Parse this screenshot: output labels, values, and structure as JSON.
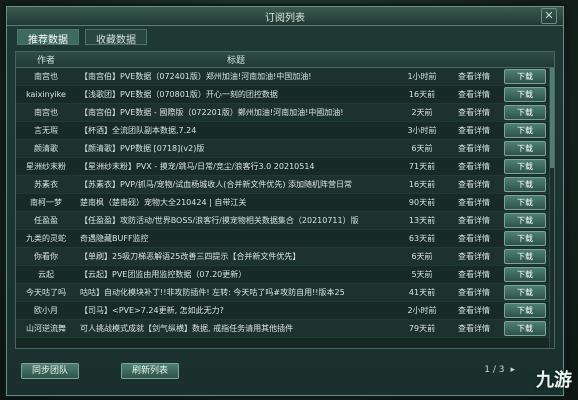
{
  "window": {
    "title": "订阅列表"
  },
  "tabs": [
    {
      "label": "推荐数据",
      "active": true
    },
    {
      "label": "收藏数据",
      "active": false
    }
  ],
  "table": {
    "headers": [
      "作者",
      "标题",
      "",
      "",
      ""
    ],
    "rows": [
      {
        "author": "南宫也",
        "title": "【南宫伯】PVE数据（072401版）郑州加油!河南加油!中国加油!",
        "time": "1小时前",
        "detail": "查看详情",
        "download": "下载"
      },
      {
        "author": "kaixinyike",
        "title": "【浅歌团】PVE数据（070801版）开心一刻的团控数据",
        "time": "16天前",
        "detail": "查看详情",
        "download": "下载"
      },
      {
        "author": "南宫也",
        "title": "【南宫伯】PVE数据 - 國際版（072201版）鄭州加油!河南加油!中國加油!",
        "time": "2天前",
        "detail": "查看详情",
        "download": "下载"
      },
      {
        "author": "言无瑕",
        "title": "【杯酒】全流团队副本数据,7.24",
        "time": "3小时前",
        "detail": "查看详情",
        "download": "下载"
      },
      {
        "author": "颜清歌",
        "title": "【颜清歌】PVP数据 [0718](v2)版",
        "time": "6天前",
        "detail": "查看详情",
        "download": "下载"
      },
      {
        "author": "星洲纱末粉",
        "title": "【星洲纱末粉】PVX - 摸宠/跳马/日常/竞尘/浪客行3.0 20210514",
        "time": "71天前",
        "detail": "查看详情",
        "download": "下载"
      },
      {
        "author": "苏素衣",
        "title": "【苏素衣】PVP/抓马/宠物/试血杨城收人(合并新文件优先) 添加随机阵营日常",
        "time": "16天前",
        "detail": "查看详情",
        "download": "下载"
      },
      {
        "author": "南柯一梦",
        "title": "楚南枫（楚南砚）宠物大全210424 | 自带江关",
        "time": "90天前",
        "detail": "查看详情",
        "download": "下载"
      },
      {
        "author": "任盈盈",
        "title": "【任盈盈】攻防活动/世界BOSS/浪客行/摸宠物相关数据集合（20210711）版",
        "time": "13天前",
        "detail": "查看详情",
        "download": "下载"
      },
      {
        "author": "九类的灵蛇",
        "title": "奇遇隐藏BUFF监控",
        "time": "63天前",
        "detail": "查看详情",
        "download": "下载"
      },
      {
        "author": "你看你",
        "title": "【单刷】25吸刀梯恶解语25改善三四提示【合并新文件优先】",
        "time": "6天前",
        "detail": "查看详情",
        "download": "下载"
      },
      {
        "author": "云起",
        "title": "【云起】PVE团监由用监控数据（07.20更新）",
        "time": "5天前",
        "detail": "查看详情",
        "download": "下载"
      },
      {
        "author": "今天咕了吗",
        "title": "咕咕】自动化模块补丁!!非攻防插件! 左转: 今天咕了吗#攻防自用!!版本25",
        "time": "41天前",
        "detail": "查看详情",
        "download": "下载"
      },
      {
        "author": "欧小月",
        "title": "【司马】<PVE>7.24更新, 怎如此无力?",
        "time": "2小时前",
        "detail": "查看详情",
        "download": "下载"
      },
      {
        "author": "山河逆流舞",
        "title": "可人挑战模式成就【剑气纵横】数据, 戒指任务请用其他插件",
        "time": "79天前",
        "detail": "查看详情",
        "download": "下载"
      }
    ]
  },
  "footer": {
    "sync_label": "同步团队",
    "refresh_label": "刷新列表",
    "page_text": "1 / 3",
    "next_arrow": "▸"
  },
  "watermark": "九游"
}
